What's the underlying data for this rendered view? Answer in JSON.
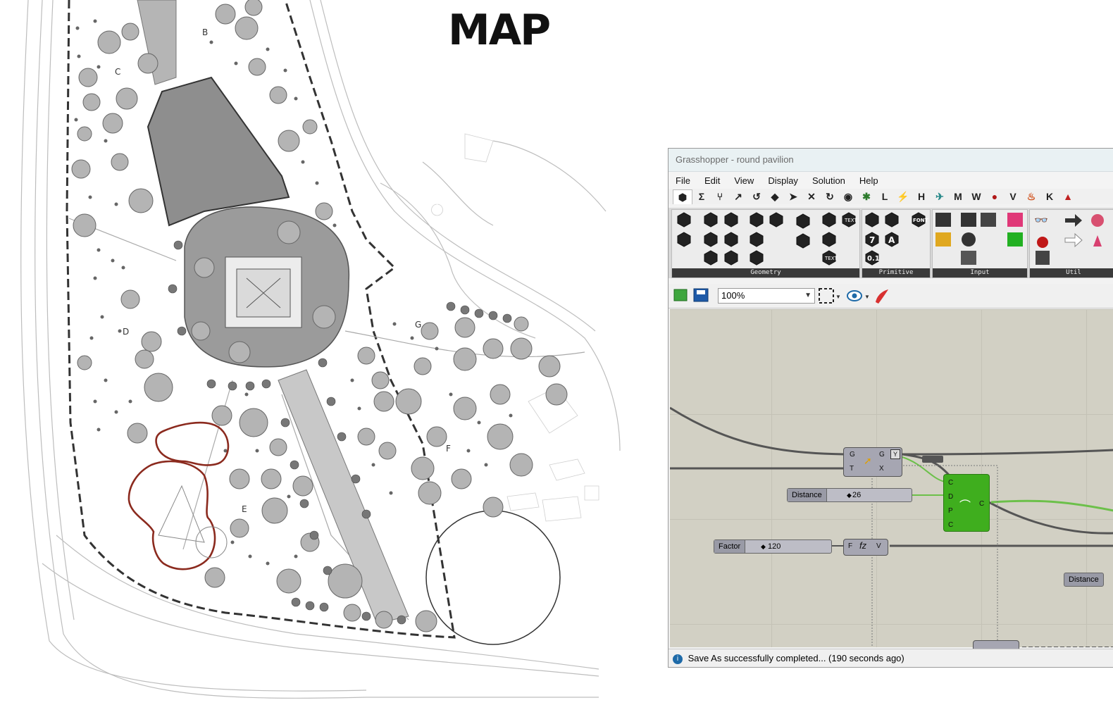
{
  "map": {
    "title": "MAP",
    "zone_labels": [
      "B",
      "C",
      "D",
      "E",
      "F",
      "G"
    ]
  },
  "window": {
    "title": "Grasshopper - round pavilion"
  },
  "menu": [
    "File",
    "Edit",
    "View",
    "Display",
    "Solution",
    "Help"
  ],
  "tabs": [
    "Σ",
    "L",
    "H",
    "M",
    "W",
    "V",
    "K"
  ],
  "ribbon_panels": [
    "Geometry",
    "Primitive",
    "Input",
    "Util"
  ],
  "ribbon_text": {
    "font": "FONT",
    "text": "TEXT",
    "seven": "7",
    "a": "A",
    "decimal": "0.1"
  },
  "toolbar": {
    "zoom": "100%"
  },
  "canvas": {
    "node_gate": {
      "in1": "G",
      "in2": "T",
      "out1": "G",
      "out2": "X"
    },
    "node_green": {
      "in1": "C",
      "in2": "D",
      "in3": "P",
      "in4": "C",
      "out": "C"
    },
    "node_expr": {
      "in": "F",
      "out": "V"
    },
    "slider_distance": {
      "label": "Distance",
      "value": "26"
    },
    "slider_factor": {
      "label": "Factor",
      "value": "120"
    },
    "tag_distance": "Distance"
  },
  "status": {
    "text": "Save As successfully completed... (190 seconds ago)"
  },
  "colors": {
    "green_node": "#3fae1e",
    "ribbon_dark": "#3a3a3a",
    "canvas": "#d2d0c4",
    "curve_red": "#8b2a1e"
  }
}
